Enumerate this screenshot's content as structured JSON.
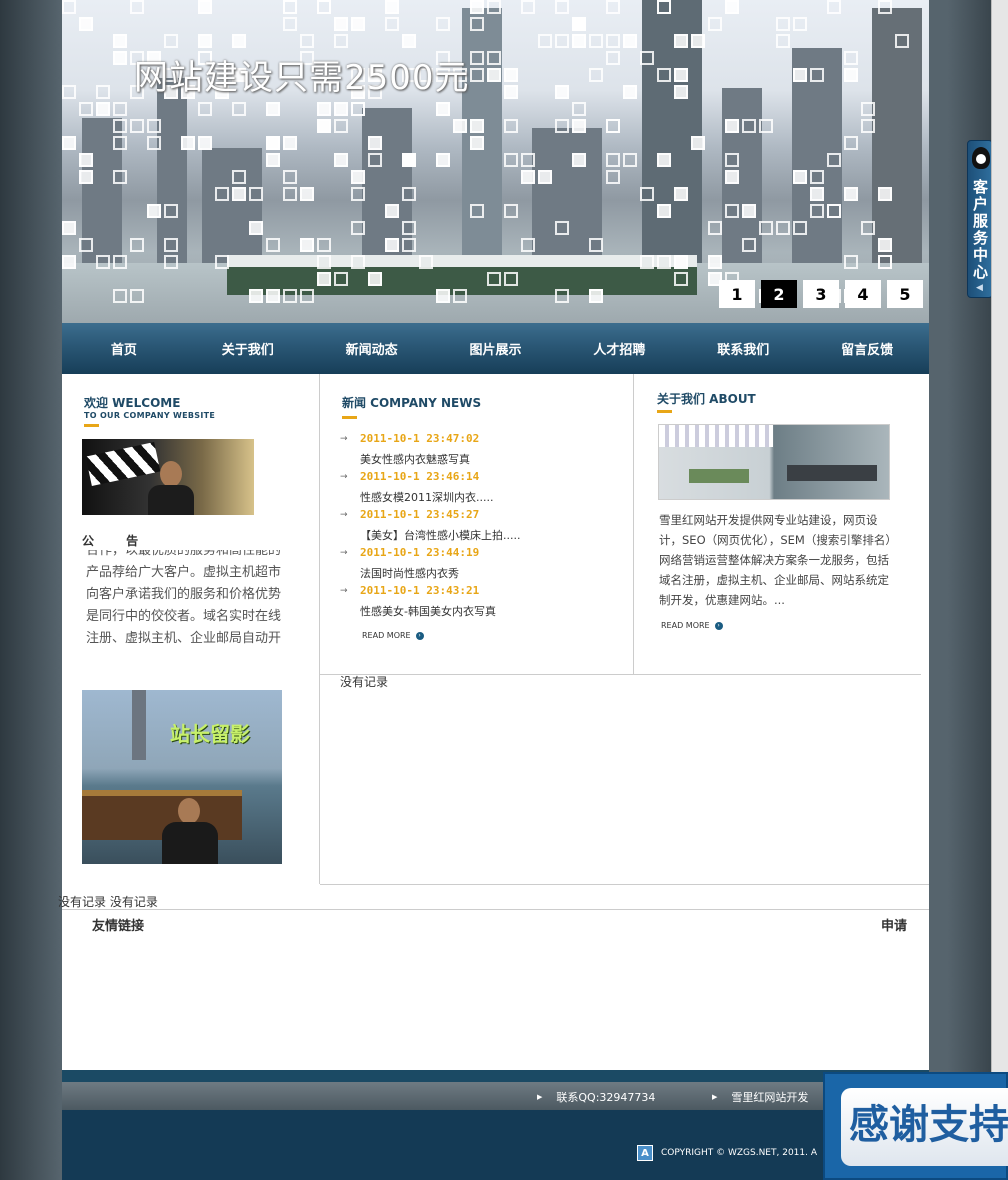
{
  "banner": {
    "title": "网站建设只需2500元",
    "pages": [
      "1",
      "2",
      "3",
      "4",
      "5"
    ],
    "active_page": "2"
  },
  "nav": [
    "首页",
    "关于我们",
    "新闻动态",
    "图片展示",
    "人才招聘",
    "联系我们",
    "留言反馈"
  ],
  "welcome": {
    "title": "欢迎 WELCOME",
    "subtitle": "TO OUR COMPANY WEBSITE",
    "notice_title": "公 告",
    "notice_text": "合作，以最优质的服务和高性能的产品荐给广大客户。虚拟主机超市向客户承诺我们的服务和价格优势是同行中的佼佼者。域名实时在线注册、虚拟主机、企业邮局自动开",
    "photo2_caption": "站长留影"
  },
  "news": {
    "title": "新闻 COMPANY NEWS",
    "items": [
      {
        "date": "2011-10-1 23:47:02",
        "title": "美女性感内衣魅惑写真"
      },
      {
        "date": "2011-10-1 23:46:14",
        "title": "性感女模2011深圳内衣....."
      },
      {
        "date": "2011-10-1 23:45:27",
        "title": "【美女】台湾性感小模床上拍....."
      },
      {
        "date": "2011-10-1 23:44:19",
        "title": "法国时尚性感内衣秀"
      },
      {
        "date": "2011-10-1 23:43:21",
        "title": "性感美女-韩国美女内衣写真"
      }
    ],
    "more": "READ MORE"
  },
  "about": {
    "title": "关于我们 ABOUT",
    "text": "雪里红网站开发提供网专业站建设，网页设计，SEO（网页优化），SEM（搜索引擎排名）网络营销运营整体解决方案条一龙服务，包括域名注册，虚拟主机、企业邮局、网站系统定制开发，优惠建网站。...",
    "more": "READ MORE"
  },
  "no_record_mid": "没有记录",
  "no_record_bottom": "没有记录  没有记录",
  "links": {
    "title": "友情链接",
    "apply": "申请"
  },
  "footer": {
    "qq": "联系QQ:32947734",
    "dev": "雪里红网站开发",
    "copyright": "COPYRIGHT © WZGS.NET, 2011. A",
    "badge": "A"
  },
  "side_service": "客户服务中心",
  "thanks": "感谢支持",
  "colors": {
    "accent": "#e8a617",
    "nav": "#2a5775",
    "footer": "#143a55"
  }
}
